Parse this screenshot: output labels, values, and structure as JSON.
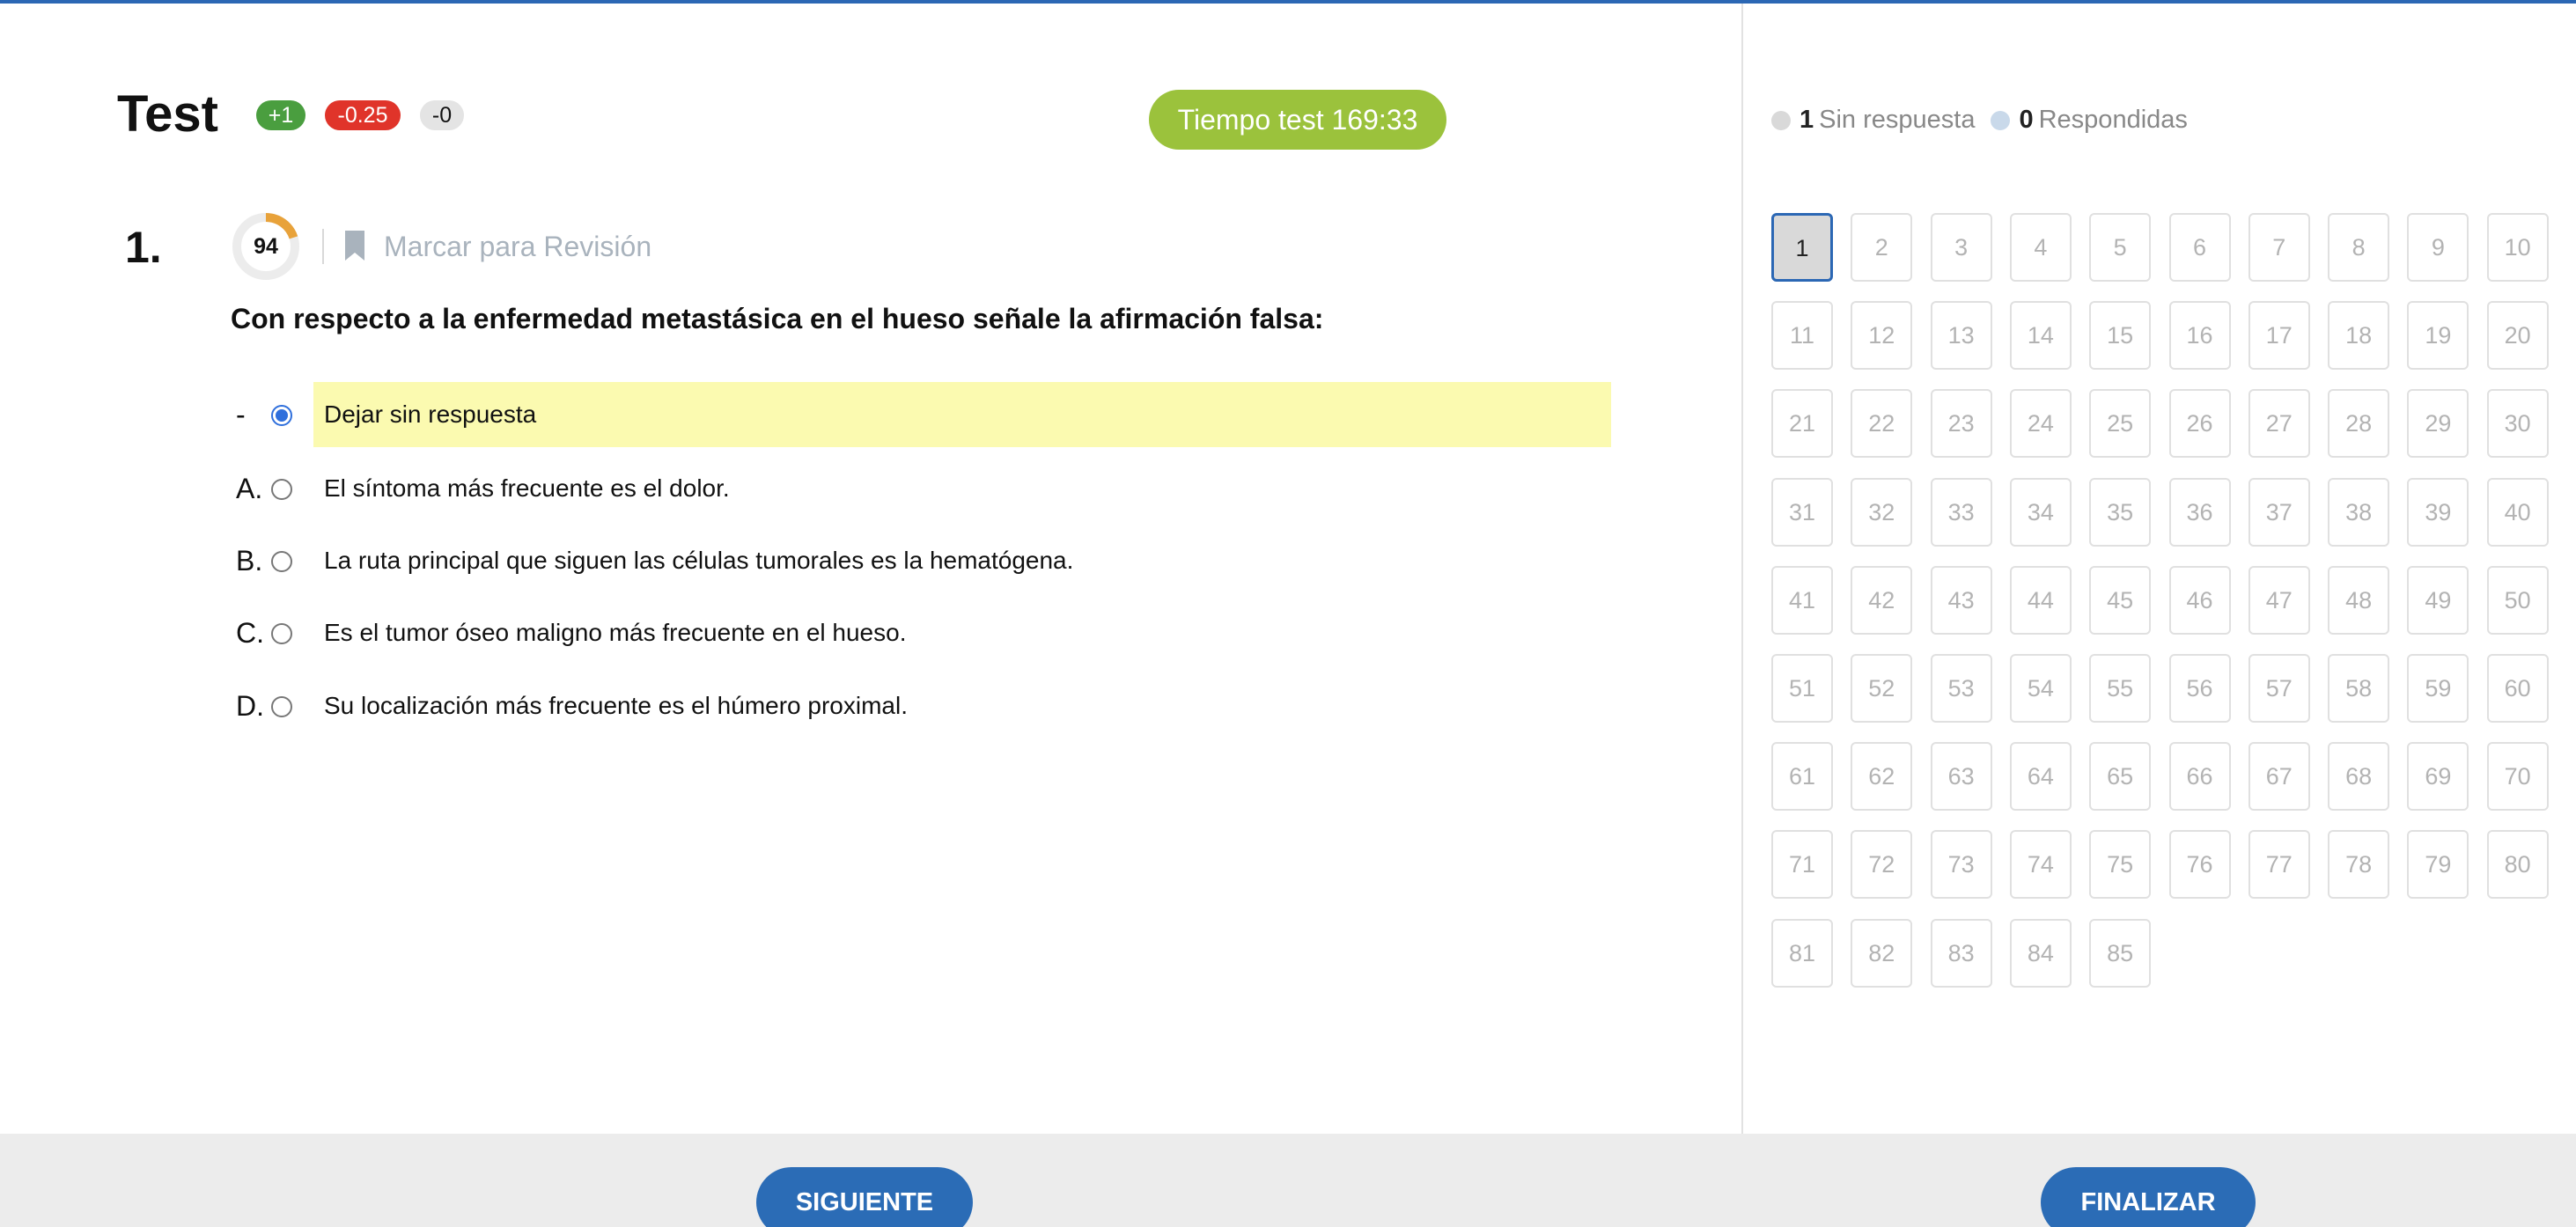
{
  "header": {
    "title": "Test",
    "badges": {
      "correct": "+1",
      "wrong": "-0.25",
      "blank": "-0"
    },
    "timer": "Tiempo test 169:33"
  },
  "question": {
    "number": "1.",
    "score": "94",
    "score_fraction": 0.2,
    "mark_review": "Marcar para Revisión",
    "text": "Con respecto a la enfermedad metastásica en el hueso señale la afirmación falsa:",
    "options": [
      {
        "letter": "-",
        "text": "Dejar sin respuesta",
        "selected": true
      },
      {
        "letter": "A.",
        "text": "El síntoma más frecuente es el dolor.",
        "selected": false
      },
      {
        "letter": "B.",
        "text": "La ruta principal que siguen las células tumorales es la hematógena.",
        "selected": false
      },
      {
        "letter": "C.",
        "text": "Es el tumor óseo maligno más frecuente en el hueso.",
        "selected": false
      },
      {
        "letter": "D.",
        "text": "Su localización más frecuente es el húmero proximal.",
        "selected": false
      }
    ]
  },
  "legend": {
    "unanswered_count": "1",
    "unanswered_label": "Sin respuesta",
    "answered_count": "0",
    "answered_label": "Respondidas"
  },
  "navigator": {
    "total": 85,
    "current": 1
  },
  "footer": {
    "next_label": "SIGUIENTE",
    "finish_label": "FINALIZAR"
  },
  "colors": {
    "accent": "#2b67b4",
    "timer": "#9bc23c",
    "correct": "#4a9e3f",
    "wrong": "#e0342a",
    "selected_option": "#fbfab0",
    "donut": "#e8a23a"
  }
}
